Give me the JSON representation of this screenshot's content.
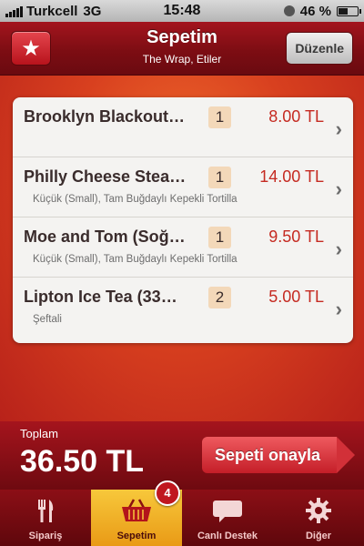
{
  "status": {
    "carrier": "Turkcell",
    "network": "3G",
    "time": "15:48",
    "battery": "46 %",
    "battery_level": 0.46
  },
  "nav": {
    "title": "Sepetim",
    "subtitle": "The Wrap, Etiler",
    "edit_label": "Düzenle"
  },
  "items": [
    {
      "name": "Brooklyn Blackout…",
      "qty": "1",
      "price": "8.00 TL",
      "options": ""
    },
    {
      "name": "Philly Cheese Stea…",
      "qty": "1",
      "price": "14.00 TL",
      "options": "Küçük (Small), Tam Buğdaylı Kepekli Tortilla"
    },
    {
      "name": "Moe and Tom (Soğ…",
      "qty": "1",
      "price": "9.50 TL",
      "options": "Küçük (Small), Tam Buğdaylı Kepekli Tortilla"
    },
    {
      "name": "Lipton Ice Tea (33…",
      "qty": "2",
      "price": "5.00 TL",
      "options": "Şeftali"
    }
  ],
  "total": {
    "label": "Toplam",
    "value": "36.50 TL",
    "confirm_label": "Sepeti onayla"
  },
  "tabs": [
    {
      "label": "Sipariş",
      "icon": "utensils-icon"
    },
    {
      "label": "Sepetim",
      "icon": "basket-icon",
      "badge": "4"
    },
    {
      "label": "Canlı Destek",
      "icon": "chat-bubble-icon"
    },
    {
      "label": "Diğer",
      "icon": "gear-icon"
    }
  ],
  "colors": {
    "accent": "#a3151e",
    "price": "#c52a21",
    "active_tab": "#f0b030"
  }
}
